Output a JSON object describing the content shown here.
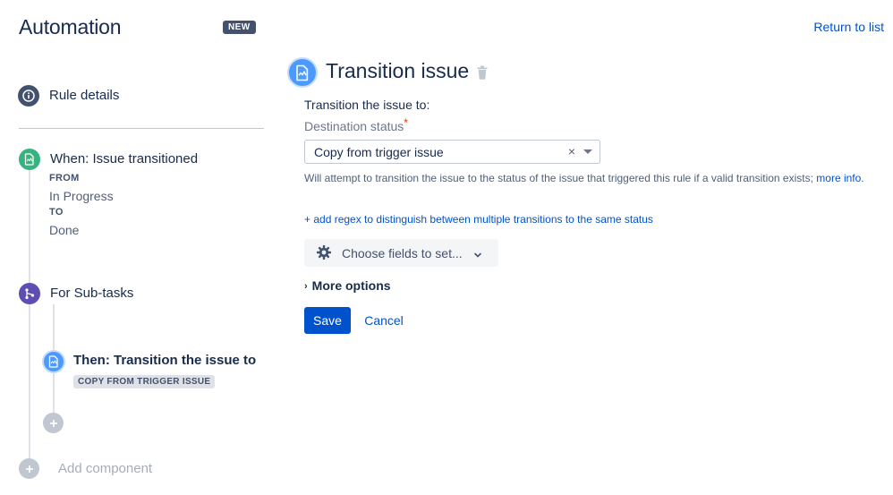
{
  "header": {
    "title": "Automation",
    "badge": "NEW",
    "return_link": "Return to list"
  },
  "sidebar": {
    "rule_details": {
      "label": "Rule details",
      "icon": "info-icon"
    },
    "trigger": {
      "title": "When: Issue transitioned",
      "icon": "issue-icon",
      "from_label": "FROM",
      "from_value": "In Progress",
      "to_label": "TO",
      "to_value": "Done"
    },
    "branch": {
      "title": "For Sub-tasks",
      "icon": "branch-icon"
    },
    "action": {
      "title": "Then: Transition the issue to",
      "icon": "issue-icon",
      "lozenge": "COPY FROM TRIGGER ISSUE"
    },
    "add_component_label": "Add component"
  },
  "main": {
    "title": "Transition issue",
    "transition_label": "Transition the issue to:",
    "destination_label": "Destination status",
    "required_marker": "*",
    "select": {
      "value": "Copy from trigger issue",
      "clear": "×"
    },
    "hint": {
      "text": "Will attempt to transition the issue to the status of the issue that triggered this rule if a valid transition exists; ",
      "link": "more info."
    },
    "regex_link": "+ add regex to distinguish between multiple transitions to the same status",
    "fields_button": "Choose fields to set...",
    "more_options": "More options",
    "save": "Save",
    "cancel": "Cancel"
  },
  "colors": {
    "primary": "#0052cc",
    "trigger_green": "#36b37e",
    "branch_purple": "#5e4db2",
    "action_blue": "#4c9aff",
    "neutral_dark": "#42526e"
  }
}
